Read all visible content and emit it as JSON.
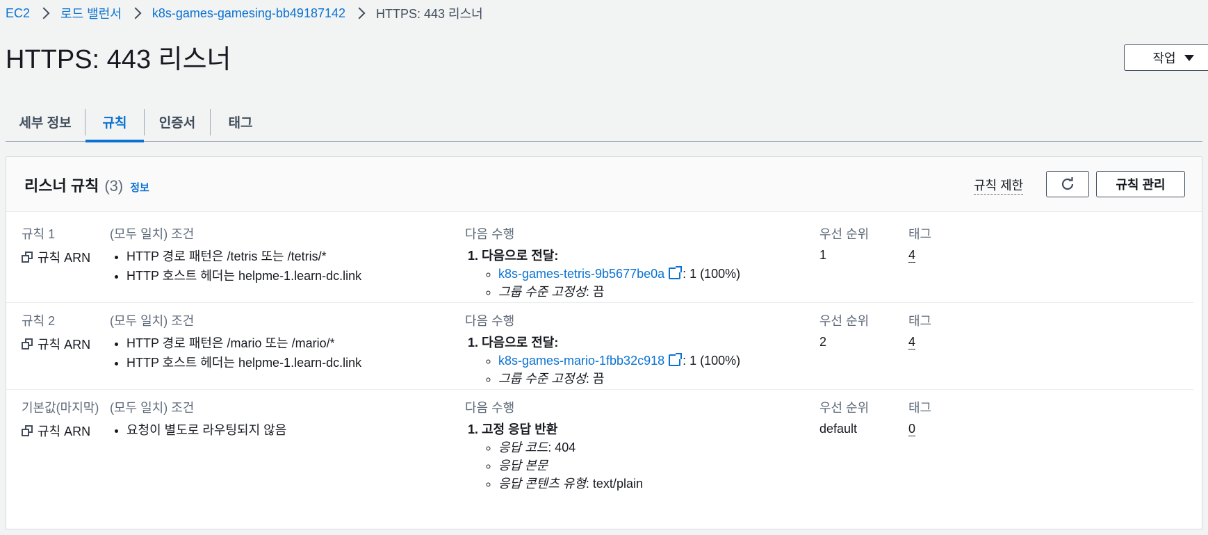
{
  "breadcrumb": [
    "EC2",
    "로드 밸런서",
    "k8s-games-gamesing-bb49187142",
    "HTTPS: 443 리스너"
  ],
  "page": {
    "title": "HTTPS: 443 리스너",
    "actions_label": "작업"
  },
  "tabs": [
    "세부 정보",
    "규칙",
    "인증서",
    "태그"
  ],
  "active_tab": "규칙",
  "panel": {
    "title": "리스너 규칙",
    "count": "(3)",
    "info": "정보",
    "limit_label": "규칙 제한",
    "manage_label": "규칙 관리"
  },
  "columns": {
    "conditions": "(모두 일치) 조건",
    "action": "다음 수행",
    "priority": "우선 순위",
    "tags": "태그"
  },
  "rules": [
    {
      "name": "규칙 1",
      "arn_label": "규칙 ARN",
      "conditions": [
        "HTTP 경로 패턴은 /tetris 또는 /tetris/*",
        "HTTP 호스트 헤더는 helpme-1.learn-dc.link"
      ],
      "action_title": "다음으로 전달:",
      "target_link": "k8s-games-tetris-9b5677be0a",
      "target_suffix": ": 1 (100%)",
      "stickiness_label": "그룹 수준 고정성",
      "stickiness_value": ": 끔",
      "priority": "1",
      "tags": "4"
    },
    {
      "name": "규칙 2",
      "arn_label": "규칙 ARN",
      "conditions": [
        "HTTP 경로 패턴은 /mario 또는 /mario/*",
        "HTTP 호스트 헤더는 helpme-1.learn-dc.link"
      ],
      "action_title": "다음으로 전달:",
      "target_link": "k8s-games-mario-1fbb32c918",
      "target_suffix": ": 1 (100%)",
      "stickiness_label": "그룹 수준 고정성",
      "stickiness_value": ": 끔",
      "priority": "2",
      "tags": "4"
    },
    {
      "name": "기본값(마지막)",
      "arn_label": "규칙 ARN",
      "conditions": [
        "요청이 별도로 라우팅되지 않음"
      ],
      "action_title": "고정 응답 반환",
      "response_code_label": "응답 코드",
      "response_code_value": ": 404",
      "response_body_label": "응답 본문",
      "content_type_label": "응답 콘텐츠 유형",
      "content_type_value": ": text/plain",
      "priority": "default",
      "tags": "0"
    }
  ],
  "colors": {
    "link": "#0972d3",
    "text": "#16191f",
    "muted": "#5f6b7a",
    "background": "#f2f3f3"
  }
}
